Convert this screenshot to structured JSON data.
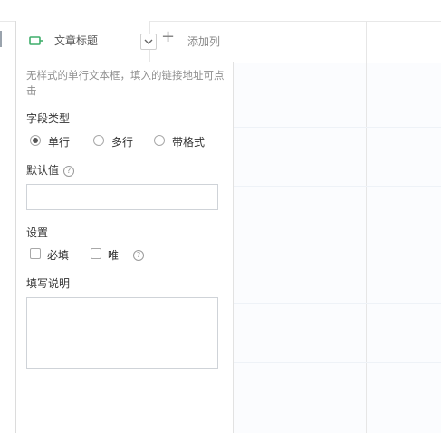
{
  "header": {
    "column_title": "文章标题",
    "column_icon": "single-line-text-icon",
    "dropdown_icon": "chevron-down-icon",
    "add_column_icon": "plus-icon",
    "add_column_label": "添加列"
  },
  "panel": {
    "description": "无样式的单行文本框，填入的链接地址可点击",
    "field_type_label": "字段类型",
    "field_types": [
      {
        "label": "单行",
        "checked": true
      },
      {
        "label": "多行",
        "checked": false
      },
      {
        "label": "带格式",
        "checked": false
      }
    ],
    "default_value_label": "默认值",
    "default_value": "",
    "settings_label": "设置",
    "settings": [
      {
        "label": "必填",
        "checked": false
      },
      {
        "label": "唯一",
        "checked": false
      }
    ],
    "instructions_label": "填写说明",
    "instructions_value": ""
  },
  "colors": {
    "icon_accent": "#3fae6b",
    "border": "#dcdcdc"
  }
}
